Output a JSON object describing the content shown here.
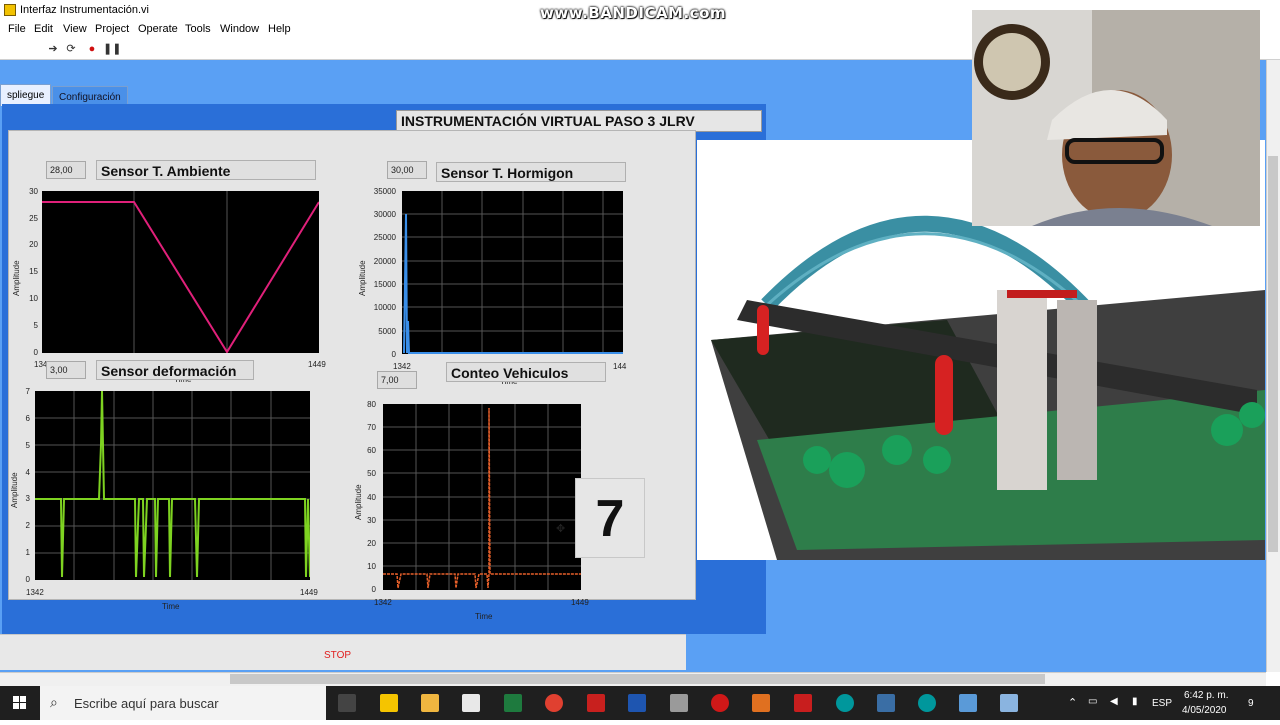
{
  "window": {
    "title": "Interfaz Instrumentación.vi",
    "watermark": "www.BANDICAM.com"
  },
  "menu": [
    "File",
    "Edit",
    "View",
    "Project",
    "Operate",
    "Tools",
    "Window",
    "Help"
  ],
  "tabs": [
    {
      "label": "spliegue",
      "active": true
    },
    {
      "label": "Configuración",
      "active": false
    }
  ],
  "banner": "INSTRUMENTACIÓN VIRTUAL PASO 3 JLRV",
  "graphs": {
    "ambiente": {
      "title": "Sensor T. Ambiente",
      "value": "28,00",
      "ylabel": "Amplitude",
      "xlabel": "Time",
      "y_ticks": [
        "30",
        "25",
        "20",
        "15",
        "10",
        "5",
        "0"
      ],
      "x_start": "1342",
      "x_end": "1449"
    },
    "hormigon": {
      "title": "Sensor T. Hormigon",
      "value": "30,00",
      "ylabel": "Amplitude",
      "xlabel": "Time",
      "y_ticks": [
        "35000",
        "30000",
        "25000",
        "20000",
        "15000",
        "10000",
        "5000",
        "0"
      ],
      "x_start": "1342",
      "x_end": "144"
    },
    "deformacion": {
      "title": "Sensor deformación",
      "value": "3,00",
      "ylabel": "Amplitude",
      "xlabel": "Time",
      "y_ticks": [
        "7",
        "6",
        "5",
        "4",
        "3",
        "2",
        "1",
        "0"
      ],
      "x_start": "1342",
      "x_end": "1449"
    },
    "vehiculos": {
      "title": "Conteo  Vehiculos",
      "value": "7,00",
      "ylabel": "Amplitude",
      "xlabel": "Time",
      "y_ticks": [
        "80",
        "70",
        "60",
        "50",
        "40",
        "30",
        "20",
        "10",
        "0"
      ],
      "x_start": "1342",
      "x_end": "1449"
    }
  },
  "counter": "7",
  "stop_label": "STOP",
  "taskbar": {
    "search_placeholder": "Escribe aquí para buscar",
    "language": "ESP",
    "time": "6:42 p. m.",
    "date": "4/05/2020",
    "notifications": "9"
  },
  "colors": {
    "panel_blue": "#5aa0f4",
    "ambiente_trace": "#e0207a",
    "hormigon_trace": "#3a8ee8",
    "deformacion_trace": "#7ed321",
    "vehiculos_trace": "#e8602a"
  },
  "chart_data": [
    {
      "type": "line",
      "title": "Sensor T. Ambiente",
      "ylabel": "Amplitude",
      "xlabel": "Time",
      "ylim": [
        0,
        30
      ],
      "x": [
        1342,
        1380,
        1420,
        1449
      ],
      "series": [
        {
          "values": [
            28,
            28,
            0,
            28
          ]
        }
      ]
    },
    {
      "type": "line",
      "title": "Sensor T. Hormigon",
      "ylabel": "Amplitude",
      "xlabel": "Time",
      "ylim": [
        0,
        35000
      ],
      "x": [
        1342,
        1343,
        1344,
        1345
      ],
      "series": [
        {
          "values": [
            0,
            30000,
            0,
            0
          ]
        }
      ]
    },
    {
      "type": "line",
      "title": "Sensor deformación",
      "ylabel": "Amplitude",
      "xlabel": "Time",
      "ylim": [
        0,
        7
      ],
      "x": [
        1342,
        1360,
        1366,
        1368,
        1370,
        1390,
        1395,
        1400,
        1447,
        1449
      ],
      "series": [
        {
          "values": [
            3,
            3,
            7,
            3,
            3,
            0,
            3,
            0,
            3,
            0
          ]
        }
      ]
    },
    {
      "type": "line",
      "title": "Conteo  Vehiculos",
      "ylabel": "Amplitude",
      "xlabel": "Time",
      "ylim": [
        0,
        80
      ],
      "x": [
        1342,
        1350,
        1370,
        1390,
        1400,
        1402,
        1449
      ],
      "series": [
        {
          "values": [
            7,
            0,
            7,
            0,
            77,
            7,
            7
          ]
        }
      ]
    }
  ]
}
